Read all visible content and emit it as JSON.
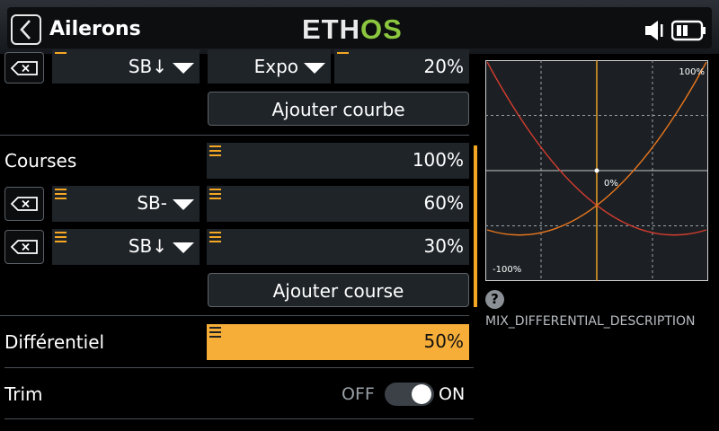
{
  "header": {
    "title": "Ailerons",
    "logo": {
      "part1": "ETH",
      "part2": "OS"
    }
  },
  "rows": {
    "top": {
      "switch": "SB↓",
      "curve_type": "Expo",
      "value": "20%"
    },
    "add_curve": "Ajouter courbe",
    "courses": {
      "label": "Courses",
      "value": "100%",
      "items": [
        {
          "switch": "SB-",
          "value": "60%"
        },
        {
          "switch": "SB↓",
          "value": "30%"
        }
      ],
      "add_button": "Ajouter course"
    },
    "differential": {
      "label": "Différentiel",
      "value": "50%"
    },
    "trim": {
      "label": "Trim",
      "off": "OFF",
      "on": "ON",
      "state": true
    }
  },
  "graph": {
    "label_max": "100%",
    "label_center": "0%",
    "label_min": "-100%",
    "curve_colors": [
      "#d33c2e",
      "#e8761e"
    ],
    "center_line_color": "#f5a623"
  },
  "help": {
    "icon": "help-icon",
    "description": "MIX_DIFFERENTIAL_DESCRIPTION"
  },
  "colors": {
    "accent": "#f5a623",
    "highlight_bg": "#f7ae38",
    "panel_bg": "#1f2429"
  }
}
